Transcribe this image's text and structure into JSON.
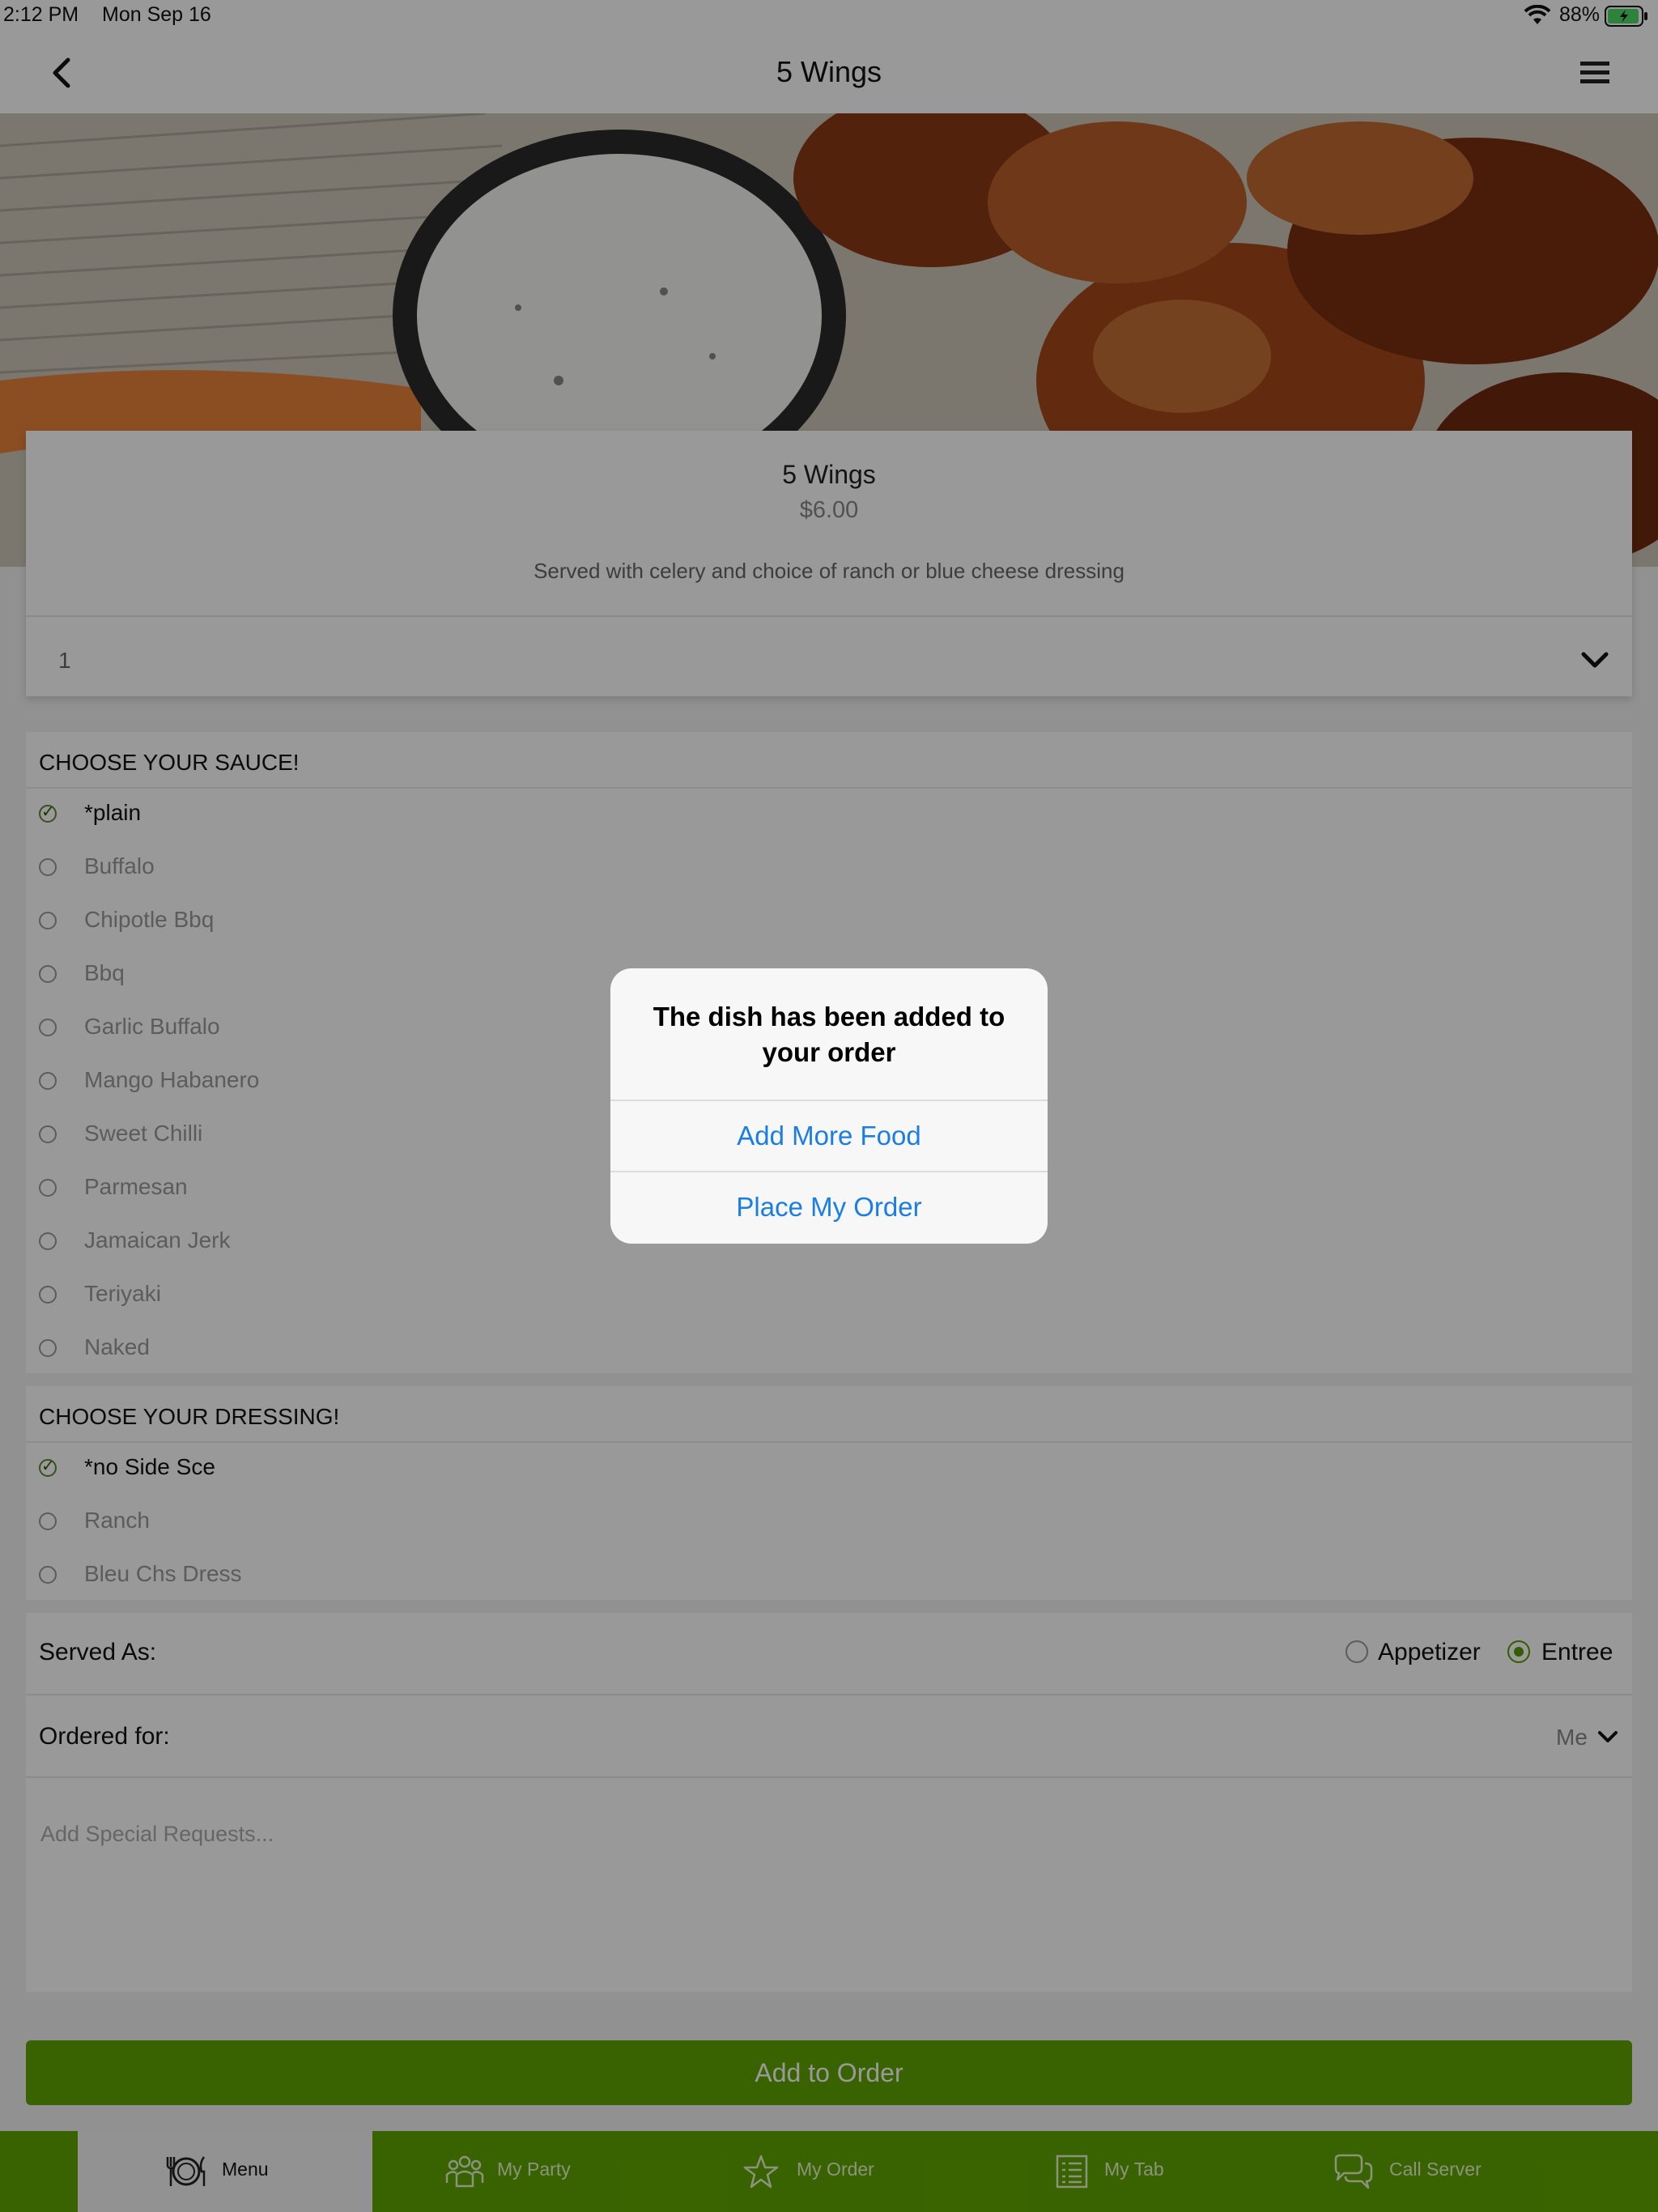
{
  "status_bar": {
    "time": "2:12 PM",
    "date": "Mon Sep 16",
    "battery": "88%"
  },
  "nav": {
    "title": "5 Wings"
  },
  "item": {
    "name": "5 Wings",
    "price": "$6.00",
    "description": "Served with celery and choice of ranch or blue cheese dressing",
    "quantity": "1"
  },
  "sauce": {
    "title": "CHOOSE YOUR SAUCE!",
    "options": [
      {
        "label": "*plain",
        "selected": true
      },
      {
        "label": "Buffalo",
        "selected": false
      },
      {
        "label": "Chipotle Bbq",
        "selected": false
      },
      {
        "label": "Bbq",
        "selected": false
      },
      {
        "label": "Garlic Buffalo",
        "selected": false
      },
      {
        "label": "Mango Habanero",
        "selected": false
      },
      {
        "label": "Sweet Chilli",
        "selected": false
      },
      {
        "label": "Parmesan",
        "selected": false
      },
      {
        "label": "Jamaican Jerk",
        "selected": false
      },
      {
        "label": "Teriyaki",
        "selected": false
      },
      {
        "label": "Naked",
        "selected": false
      }
    ]
  },
  "dressing": {
    "title": "CHOOSE YOUR DRESSING!",
    "options": [
      {
        "label": "*no Side Sce",
        "selected": true
      },
      {
        "label": "Ranch",
        "selected": false
      },
      {
        "label": "Bleu Chs Dress",
        "selected": false
      }
    ]
  },
  "served_as": {
    "label": "Served As:",
    "options": [
      "Appetizer",
      "Entree"
    ],
    "selected": "Entree"
  },
  "ordered_for": {
    "label": "Ordered for:",
    "value": "Me"
  },
  "special_requests": {
    "placeholder": "Add Special Requests..."
  },
  "add_button": {
    "label": "Add to Order"
  },
  "tabs": [
    {
      "label": "Menu",
      "icon": "utensils-icon",
      "active": true
    },
    {
      "label": "My Party",
      "icon": "people-icon",
      "active": false
    },
    {
      "label": "My Order",
      "icon": "star-icon",
      "active": false
    },
    {
      "label": "My Tab",
      "icon": "list-icon",
      "active": false
    },
    {
      "label": "Call Server",
      "icon": "chat-icon",
      "active": false
    }
  ],
  "alert": {
    "message": "The dish has been added to your order",
    "buttons": [
      "Add More Food",
      "Place My Order"
    ]
  },
  "colors": {
    "accent_green": "#5fa600",
    "link_blue": "#1a7ee6"
  }
}
